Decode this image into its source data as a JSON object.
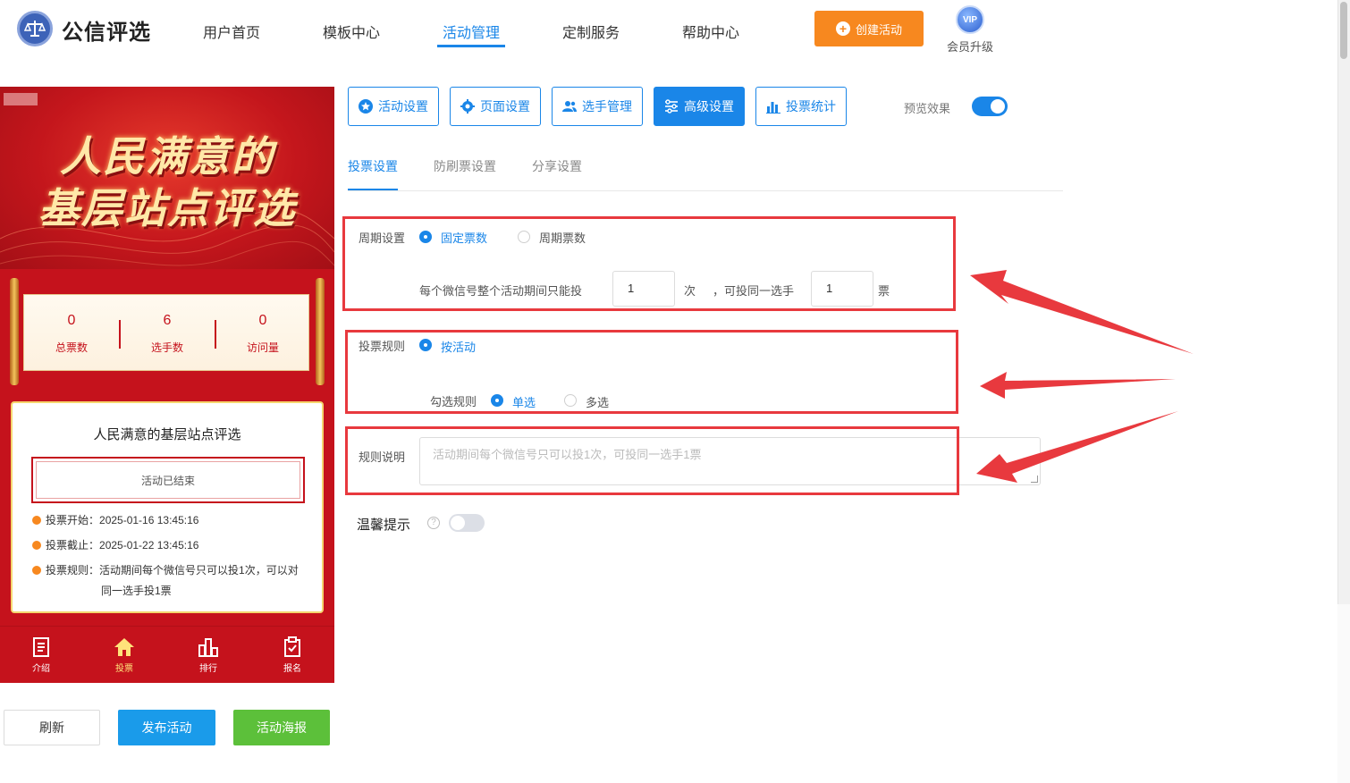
{
  "brand": {
    "name": "公信评选"
  },
  "nav": {
    "items": [
      {
        "label": "用户首页"
      },
      {
        "label": "模板中心"
      },
      {
        "label": "活动管理"
      },
      {
        "label": "定制服务"
      },
      {
        "label": "帮助中心"
      }
    ],
    "active_index": 2
  },
  "header_actions": {
    "create_label": "创建活动",
    "vip_badge": "VIP",
    "vip_label": "会员升级"
  },
  "preview": {
    "banner_lines": [
      "人民满意的",
      "基层站点评选"
    ],
    "stats": [
      {
        "value": "0",
        "label": "总票数"
      },
      {
        "value": "6",
        "label": "选手数"
      },
      {
        "value": "0",
        "label": "访问量"
      }
    ],
    "card_title": "人民满意的基层站点评选",
    "status": "活动已结束",
    "info": [
      {
        "label": "投票开始：",
        "value": "2025-01-16 13:45:16"
      },
      {
        "label": "投票截止：",
        "value": "2025-01-22 13:45:16"
      },
      {
        "label": "投票规则：",
        "value": "活动期间每个微信号只可以投1次，可以对",
        "cont": "同一选手投1票"
      }
    ],
    "tabbar": [
      {
        "label": "介绍",
        "icon": "document-icon"
      },
      {
        "label": "投票",
        "icon": "home-icon"
      },
      {
        "label": "排行",
        "icon": "bar-chart-icon"
      },
      {
        "label": "报名",
        "icon": "clipboard-icon"
      }
    ],
    "tabbar_active": 1
  },
  "bottom_buttons": {
    "refresh": "刷新",
    "publish": "发布活动",
    "poster": "活动海报"
  },
  "actions": [
    {
      "label": "活动设置",
      "icon": "star-icon"
    },
    {
      "label": "页面设置",
      "icon": "gear-icon"
    },
    {
      "label": "选手管理",
      "icon": "users-icon"
    },
    {
      "label": "高级设置",
      "icon": "sliders-icon"
    },
    {
      "label": "投票统计",
      "icon": "chart-icon"
    }
  ],
  "active_action": 3,
  "preview_toggle": {
    "label": "预览效果",
    "on": true
  },
  "subtabs": {
    "items": [
      "投票设置",
      "防刷票设置",
      "分享设置"
    ],
    "active_index": 0
  },
  "form": {
    "period": {
      "label": "周期设置",
      "options": [
        "固定票数",
        "周期票数"
      ],
      "selected": 0,
      "sentence_prefix": "每个微信号整个活动期间只能投",
      "times_value": "1",
      "times_unit": "次",
      "sentence_mid": "，可投同一选手",
      "votes_value": "1",
      "votes_unit": "票"
    },
    "rule": {
      "label": "投票规则",
      "option": "按活动",
      "check_label": "勾选规则",
      "check_options": [
        "单选",
        "多选"
      ],
      "check_selected": 0
    },
    "description": {
      "label": "规则说明",
      "placeholder": "活动期间每个微信号只可以投1次，可投同一选手1票"
    },
    "tips": {
      "label": "温馨提示",
      "help": "?",
      "on": false
    }
  },
  "colors": {
    "accent": "#1a86e8",
    "orange": "#f7881f",
    "highlight": "#e8393e",
    "phone_red": "#c5121c",
    "green": "#5cc03a"
  }
}
